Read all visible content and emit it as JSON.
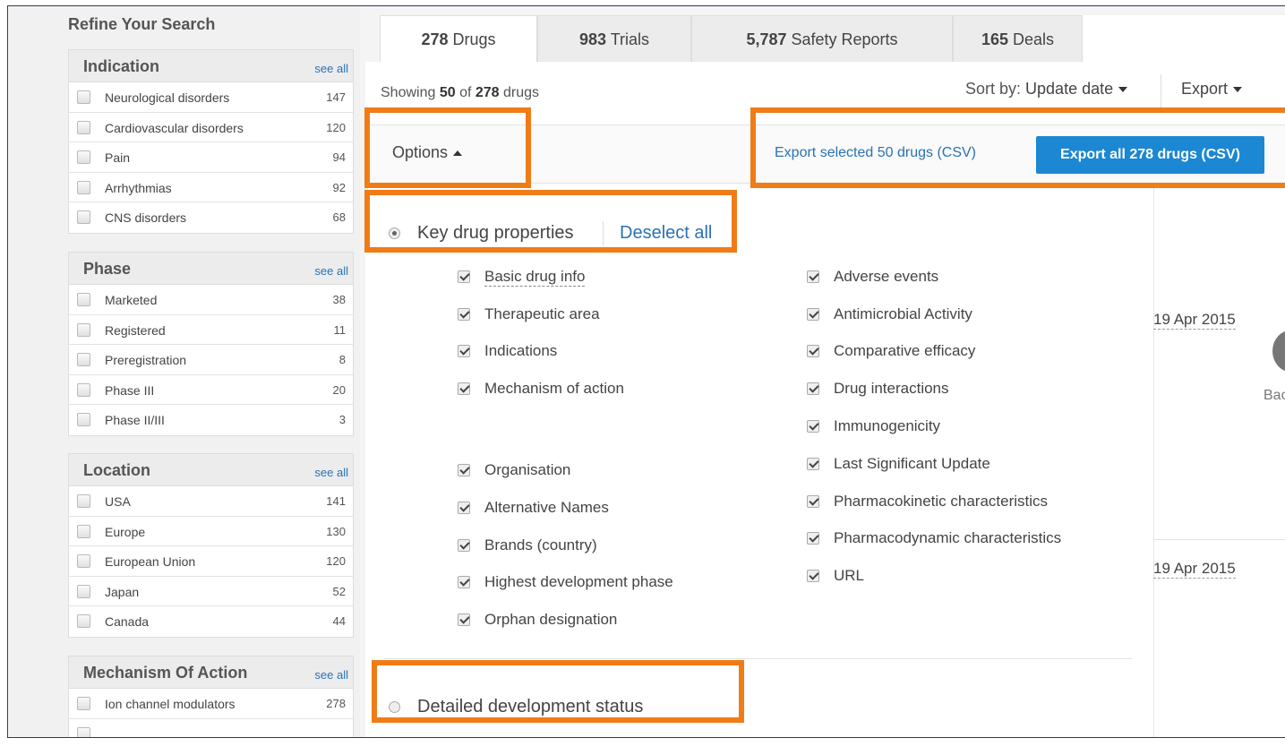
{
  "sidebar": {
    "title": "Refine Your Search",
    "facets": [
      {
        "name": "Indication",
        "see_all": "see all",
        "rows": [
          {
            "label": "Neurological disorders",
            "count": "147"
          },
          {
            "label": "Cardiovascular disorders",
            "count": "120"
          },
          {
            "label": "Pain",
            "count": "94"
          },
          {
            "label": "Arrhythmias",
            "count": "92"
          },
          {
            "label": "CNS disorders",
            "count": "68"
          }
        ]
      },
      {
        "name": "Phase",
        "see_all": "see all",
        "rows": [
          {
            "label": "Marketed",
            "count": "38"
          },
          {
            "label": "Registered",
            "count": "11"
          },
          {
            "label": "Preregistration",
            "count": "8"
          },
          {
            "label": "Phase III",
            "count": "20"
          },
          {
            "label": "Phase II/III",
            "count": "3"
          }
        ]
      },
      {
        "name": "Location",
        "see_all": "see all",
        "rows": [
          {
            "label": "USA",
            "count": "141"
          },
          {
            "label": "Europe",
            "count": "130"
          },
          {
            "label": "European Union",
            "count": "120"
          },
          {
            "label": "Japan",
            "count": "52"
          },
          {
            "label": "Canada",
            "count": "44"
          }
        ]
      },
      {
        "name": "Mechanism Of Action",
        "see_all": "see all",
        "rows": [
          {
            "label": "Ion channel modulators",
            "count": "278"
          }
        ]
      }
    ]
  },
  "tabs": [
    {
      "count": "278",
      "label": " Drugs"
    },
    {
      "count": "983",
      "label": " Trials"
    },
    {
      "count": "5,787",
      "label": " Safety Reports"
    },
    {
      "count": "165",
      "label": " Deals"
    }
  ],
  "results": {
    "showing_prefix": "Showing ",
    "showing_count": "50",
    "showing_mid": " of ",
    "showing_total": "278",
    "showing_suffix": " drugs",
    "sort_label": "Sort by: ",
    "sort_value": "Update date",
    "export_label": "Export"
  },
  "options": {
    "label": "Options",
    "export_selected": "Export selected 50 drugs (CSV)",
    "export_all": "Export all 278 drugs (CSV)",
    "key_properties": "Key drug properties",
    "deselect_all": "Deselect all",
    "detailed_status": "Detailed development status",
    "left_column": [
      "Basic drug info",
      "Therapeutic area",
      "Indications",
      "Mechanism of action",
      "Organisation",
      "Alternative Names",
      "Brands (country)",
      "Highest development phase",
      "Orphan designation"
    ],
    "right_column": [
      "Adverse events",
      "Antimicrobial Activity",
      "Comparative efficacy",
      "Drug interactions",
      "Immunogenicity",
      "Last Significant Update",
      "Pharmacokinetic characteristics",
      "Pharmacodynamic characteristics",
      "URL"
    ]
  },
  "behind": {
    "date1": "19 Apr 2015",
    "date2": "19 Apr 2015",
    "bac": "Bac"
  },
  "colors": {
    "callout": "#f07c18",
    "primary_button": "#1c87d2",
    "link": "#2a72b5"
  }
}
